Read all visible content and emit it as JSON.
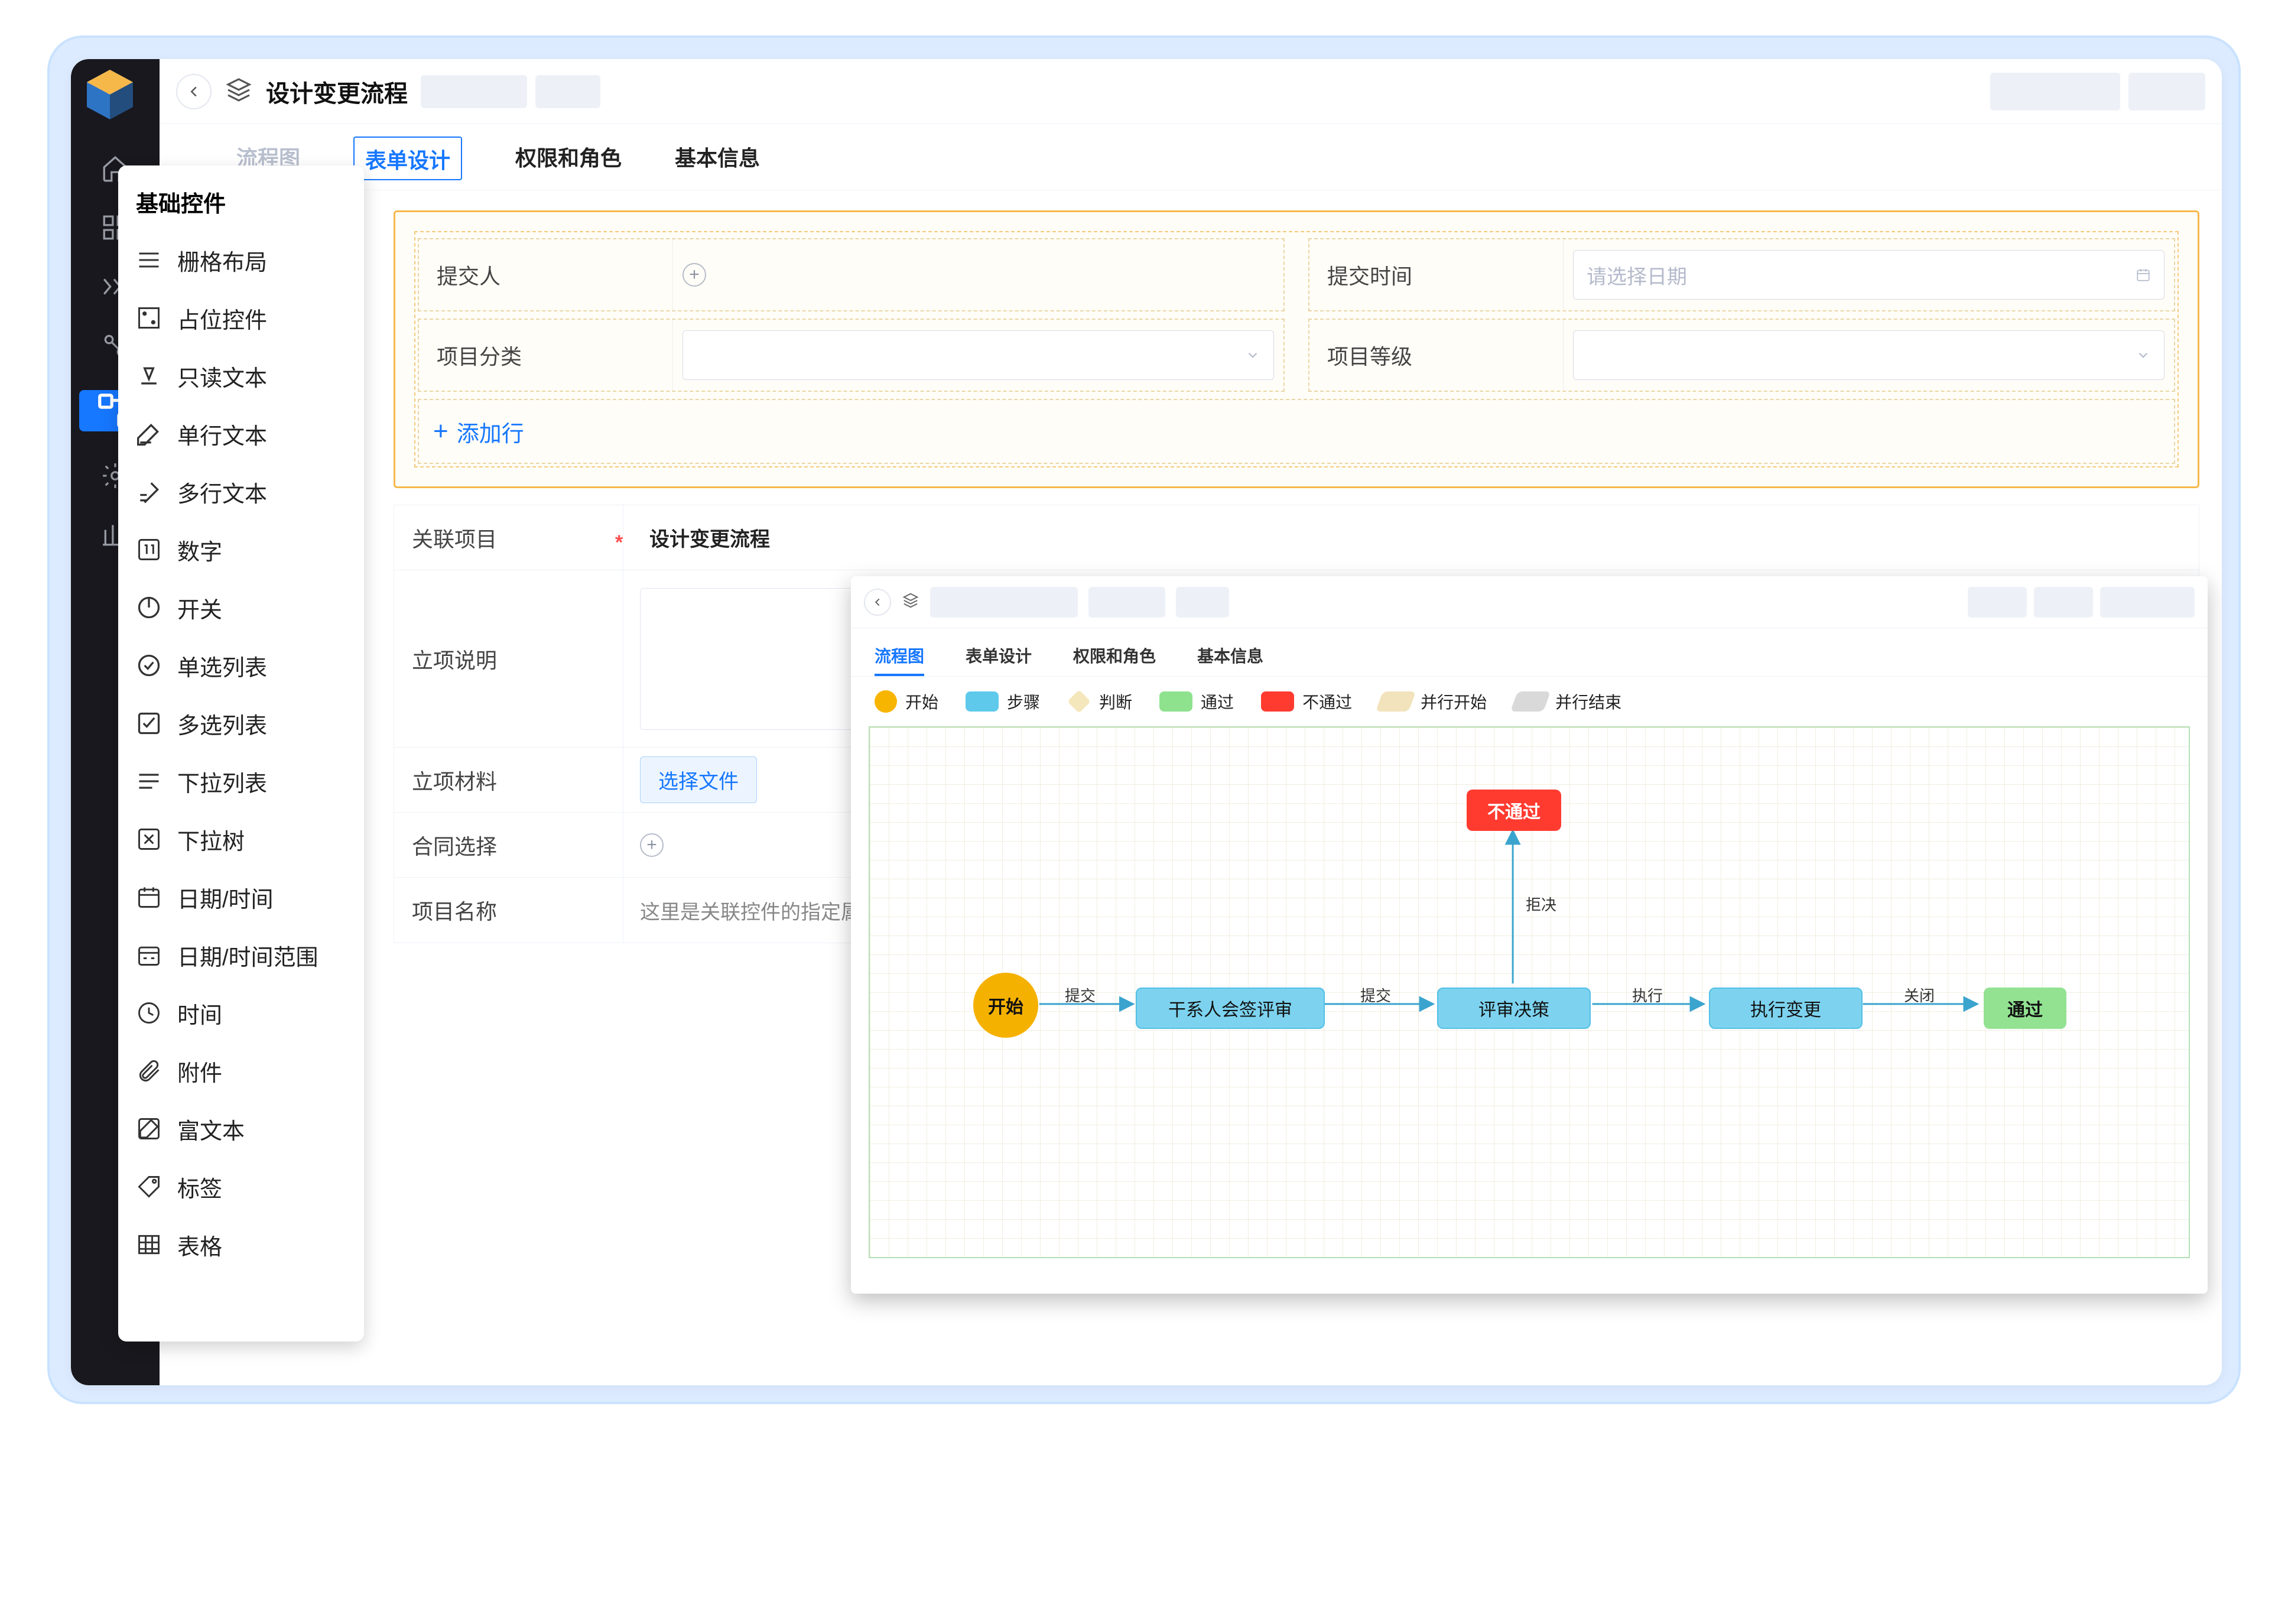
{
  "header": {
    "title": "设计变更流程",
    "pills": [
      "",
      ""
    ],
    "actions": [
      "",
      ""
    ]
  },
  "tabs": [
    "流程图",
    "表单设计",
    "权限和角色",
    "基本信息"
  ],
  "active_tab": "表单设计",
  "palette": {
    "title": "基础控件",
    "items": [
      {
        "key": "grid",
        "label": "栅格布局"
      },
      {
        "key": "placeholder",
        "label": "占位控件"
      },
      {
        "key": "readonly",
        "label": "只读文本"
      },
      {
        "key": "singleline",
        "label": "单行文本"
      },
      {
        "key": "multiline",
        "label": "多行文本"
      },
      {
        "key": "number",
        "label": "数字"
      },
      {
        "key": "switch",
        "label": "开关"
      },
      {
        "key": "radio",
        "label": "单选列表"
      },
      {
        "key": "checkbox",
        "label": "多选列表"
      },
      {
        "key": "dropdown",
        "label": "下拉列表"
      },
      {
        "key": "tree",
        "label": "下拉树"
      },
      {
        "key": "datetime",
        "label": "日期/时间"
      },
      {
        "key": "daterange",
        "label": "日期/时间范围"
      },
      {
        "key": "time",
        "label": "时间"
      },
      {
        "key": "attach",
        "label": "附件"
      },
      {
        "key": "rich",
        "label": "富文本"
      },
      {
        "key": "tag",
        "label": "标签"
      },
      {
        "key": "table",
        "label": "表格"
      }
    ]
  },
  "form": {
    "cells": {
      "submitter_label": "提交人",
      "submit_time_label": "提交时间",
      "submit_time_placeholder": "请选择日期",
      "category_label": "项目分类",
      "level_label": "项目等级"
    },
    "add_row": "添加行"
  },
  "static_rows": {
    "r1_label": "关联项目",
    "r1_value": "设计变更流程",
    "r2_label": "立项说明",
    "r3_label": "立项材料",
    "r3_btn": "选择文件",
    "r4_label": "合同选择",
    "r5_label": "项目名称",
    "r5_value": "这里是关联控件的指定属性"
  },
  "inner_window": {
    "tabs": [
      "流程图",
      "表单设计",
      "权限和角色",
      "基本信息"
    ],
    "active_tab": "流程图",
    "legend": {
      "start": "开始",
      "step": "步骤",
      "judge": "判断",
      "pass": "通过",
      "fail": "不通过",
      "pstart": "并行开始",
      "pend": "并行结束"
    },
    "nodes": {
      "start": "开始",
      "step1": "干系人会签评审",
      "step2": "评审决策",
      "step3": "执行变更",
      "pass": "通过",
      "fail": "不通过"
    },
    "edges": {
      "e1": "提交",
      "e2": "提交",
      "e3": "执行",
      "e4": "关闭",
      "e5": "拒决"
    }
  }
}
